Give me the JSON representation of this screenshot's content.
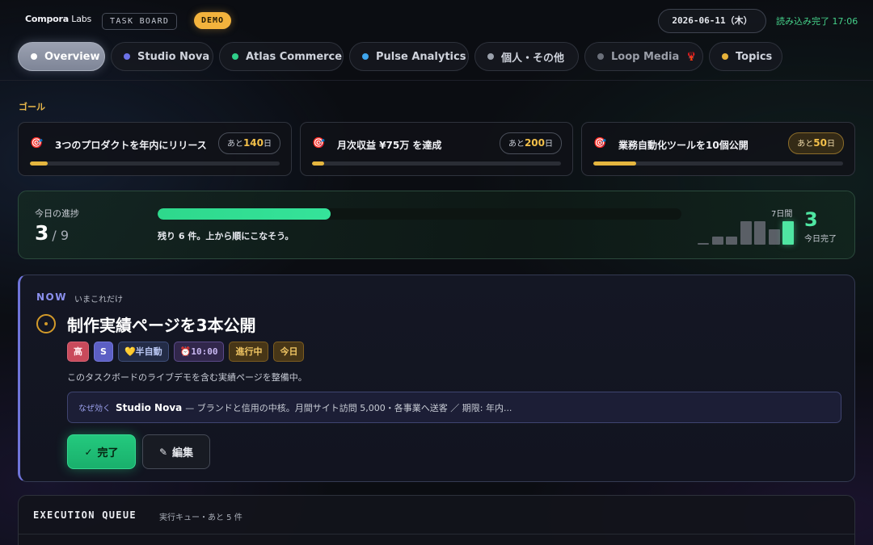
{
  "header": {
    "brand": "Compora",
    "brand_thin": " Labs",
    "board_badge": "TASK BOARD",
    "demo_badge": "DEMO",
    "date": "2026-06-11（木）",
    "status": "読み込み完了 17:06"
  },
  "tabs": [
    {
      "label": "Overview",
      "dot_color": "#ffffff",
      "active": true
    },
    {
      "label": "Studio Nova",
      "dot_color": "#6c72e8"
    },
    {
      "label": "Atlas Commerce",
      "dot_color": "#2fcf8a"
    },
    {
      "label": "Pulse Analytics",
      "dot_color": "#3fa6ee"
    },
    {
      "label": "個人・その他",
      "dot_color": "#9aa0ab"
    },
    {
      "label": "Loop Media",
      "dot_color": "#6b707a",
      "icon": "lobster-icon"
    },
    {
      "label": "Topics",
      "dot_color": "#e7b23a"
    }
  ],
  "goals": {
    "heading": "ゴール",
    "items": [
      {
        "icon": "target-icon",
        "title": "3つのプロダクトを年内にリリース",
        "prefix": "あと",
        "days": "140",
        "suffix": "日",
        "progress": 0.07
      },
      {
        "icon": "target-icon",
        "title": "月次収益 ¥75万 を達成",
        "prefix": "あと",
        "days": "200",
        "suffix": "日",
        "progress": 0.05
      },
      {
        "icon": "target-icon",
        "title": "業務自動化ツールを10個公開",
        "prefix": "あと",
        "days": "50",
        "suffix": "日",
        "progress": 0.17,
        "highlight": true
      }
    ]
  },
  "today": {
    "label": "今日の進捗",
    "done": "3",
    "total": "/ 9",
    "progress": 0.33,
    "remaining": "残り 6 件。上から順にこなそう。",
    "week_label": "7日間",
    "week_counts": [
      0,
      1,
      1,
      3,
      3,
      2,
      3
    ],
    "today_count": "3",
    "today_label": "今日完了"
  },
  "now": {
    "tag": "NOW",
    "sub": "いまこれだけ",
    "title": "制作実績ページを3本公開",
    "chips": [
      {
        "text": "高",
        "kind": "high"
      },
      {
        "text": "S",
        "kind": "s"
      },
      {
        "text": "💛半自動",
        "kind": "semi"
      },
      {
        "text": "⏰10:00",
        "kind": "time"
      },
      {
        "text": "進行中",
        "kind": "prog"
      },
      {
        "text": "今日",
        "kind": "today"
      }
    ],
    "description": "このタスクボードのライブデモを含む実績ページを整備中。",
    "why_label": "なぜ効く",
    "why_project": "Studio Nova",
    "why_text": "— ブランドと信用の中核。月間サイト訪問 5,000・各事業へ送客 ／ 期限: 年内...",
    "done_button": "完了",
    "edit_button": "編集"
  },
  "queue": {
    "title": "EXECUTION QUEUE",
    "sub": "実行キュー・あと 5 件"
  }
}
